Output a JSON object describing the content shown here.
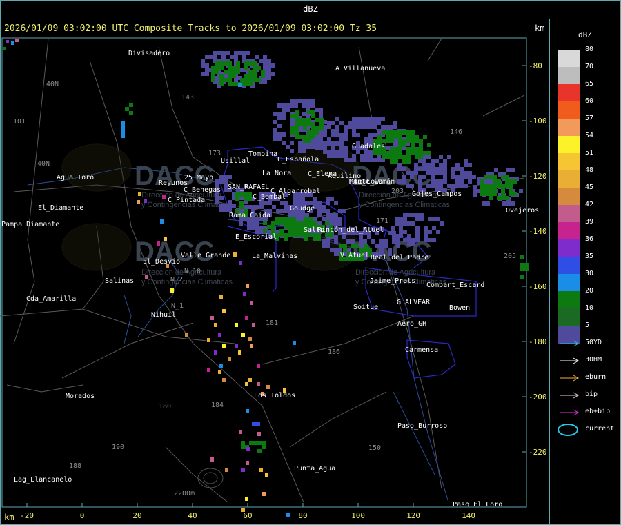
{
  "window": {
    "title": "dBZ"
  },
  "map": {
    "title": "2026/01/09 03:02:00 UTC Composite Tracks to 2026/01/09 03:02:00 Tz 35",
    "km_label_top": "km",
    "km_label_bottom": "km",
    "x_ticks": [
      "-20",
      "0",
      "20",
      "40",
      "60",
      "80",
      "100",
      "120",
      "140"
    ],
    "y_ticks": [
      "-80",
      "-100",
      "-120",
      "-140",
      "-160",
      "-180",
      "-200",
      "-220"
    ],
    "watermark": {
      "text": "DACC",
      "subtitle1": "Direccion de Agricultura",
      "subtitle2": "y Contingencias Climaticas"
    },
    "place_names": [
      "Divisadero",
      "A_Villanueva",
      "Tombina",
      "C_Española",
      "Usillal",
      "La_Nora",
      "C_Elena",
      "Aquilino",
      "Rte_Cowan",
      "Agua_Toro",
      "Reyunos",
      "25_Mayo",
      "C_Benegas",
      "SAN_RAFAEL",
      "C_Algarrobal",
      "C_Bombal",
      "Pampa_Diamante",
      "El_Diamante",
      "C_Pintada",
      "Rama_Caida",
      "Goudge",
      "Salinas",
      "El_Desvio",
      "Valle_Grande",
      "E_Escorial",
      "La_Malvinas",
      "Cda_Amarilla",
      "Morados",
      "Los_Toldos",
      "Punta_Agua",
      "Lag_Llancanelo",
      "Nihuil",
      "Soitue",
      "Aero_GH",
      "Carmensa",
      "Paso_Burroso",
      "Paso_El_Loro",
      "Compart_Escard",
      "Bowen",
      "G_ALVEAR",
      "Monte_Comán",
      "Jaime_Prats",
      "V_Atuel",
      "Real_del_Padre",
      "Gojes_Campos",
      "Ovejeros",
      "Guadales",
      "Salto",
      "Rincón_del_Atuel"
    ],
    "elevation_label": "2200m",
    "route_numbers": [
      "143",
      "146",
      "171",
      "173",
      "180",
      "181",
      "184",
      "186",
      "190",
      "101",
      "188",
      "203",
      "205",
      "40N",
      "40N",
      "N_2",
      "N_1",
      "N_10",
      "150"
    ]
  },
  "legend": {
    "title": "dBZ",
    "levels": [
      {
        "label": "80",
        "color": "#d9d9d9"
      },
      {
        "label": "70",
        "color": "#bdbdbd"
      },
      {
        "label": "65",
        "color": "#e8342a"
      },
      {
        "label": "60",
        "color": "#f15b1b"
      },
      {
        "label": "57",
        "color": "#f29a5c"
      },
      {
        "label": "54",
        "color": "#fbf22a"
      },
      {
        "label": "51",
        "color": "#f6c533"
      },
      {
        "label": "48",
        "color": "#e9ae34"
      },
      {
        "label": "45",
        "color": "#d58a3e"
      },
      {
        "label": "42",
        "color": "#c25c8c"
      },
      {
        "label": "39",
        "color": "#c6238e"
      },
      {
        "label": "36",
        "color": "#7e2ccc"
      },
      {
        "label": "35",
        "color": "#2e4ee6"
      },
      {
        "label": "30",
        "color": "#1a8de6"
      },
      {
        "label": "20",
        "color": "#0c7a10"
      },
      {
        "label": "10",
        "color": "#1b6a24"
      },
      {
        "label": "5",
        "color": "#504a9c"
      }
    ],
    "tracks": [
      {
        "label": "50YD",
        "color": "#28c8e6"
      },
      {
        "label": "30HM",
        "color": "#ffffff"
      },
      {
        "label": "eburn",
        "color": "#f2b23c"
      },
      {
        "label": "bip",
        "color": "#f4c6d8"
      },
      {
        "label": "eb+bip",
        "color": "#e62ee6"
      },
      {
        "label": "current",
        "color": "#28c8e6"
      }
    ]
  }
}
